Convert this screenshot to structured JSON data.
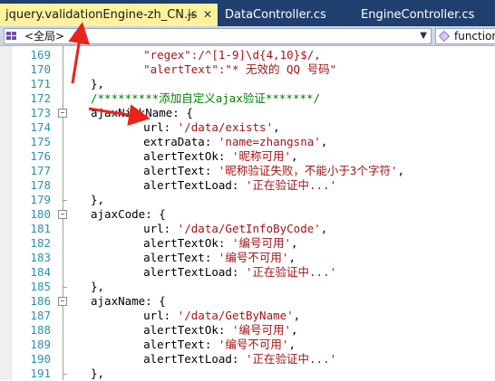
{
  "tabs": [
    {
      "label": "jquery.validationEngine-zh_CN.js",
      "active": true,
      "pin_icon": "pin-icon",
      "close_icon": "close-icon"
    },
    {
      "label": "DataController.cs",
      "active": false
    },
    {
      "label": "EngineController.cs",
      "active": false
    }
  ],
  "navbar": {
    "scope_label": "<全局>",
    "member_label": "function"
  },
  "editor": {
    "lines": [
      {
        "num": "169",
        "segs": [
          {
            "t": "    ",
            "k": ""
          },
          {
            "t": "\"regex\":/^[1-9]\\d{4,10}$/,",
            "k": "s"
          }
        ]
      },
      {
        "num": "170",
        "segs": [
          {
            "t": "    ",
            "k": ""
          },
          {
            "t": "\"alertText\":\"* 无效的 QQ 号码\"",
            "k": "s"
          }
        ]
      },
      {
        "num": "171",
        "segs": [
          {
            "t": "},",
            "k": ""
          }
        ]
      },
      {
        "num": "172",
        "segs": [
          {
            "t": "/*********添加自定义ajax验证*******/",
            "k": "c"
          }
        ]
      },
      {
        "num": "173",
        "segs": [
          {
            "t": "ajaxNickName: {",
            "k": ""
          }
        ]
      },
      {
        "num": "174",
        "segs": [
          {
            "t": "    url: ",
            "k": ""
          },
          {
            "t": "'/data/exists'",
            "k": "s"
          },
          {
            "t": ",",
            "k": ""
          }
        ]
      },
      {
        "num": "175",
        "segs": [
          {
            "t": "    extraData: ",
            "k": ""
          },
          {
            "t": "'name=zhangsna'",
            "k": "s"
          },
          {
            "t": ",",
            "k": ""
          }
        ]
      },
      {
        "num": "176",
        "segs": [
          {
            "t": "    alertTextOk: ",
            "k": ""
          },
          {
            "t": "'昵称可用'",
            "k": "s"
          },
          {
            "t": ",",
            "k": ""
          }
        ]
      },
      {
        "num": "177",
        "segs": [
          {
            "t": "    alertText: ",
            "k": ""
          },
          {
            "t": "'昵称验证失败，不能小于3个字符'",
            "k": "s"
          },
          {
            "t": ",",
            "k": ""
          }
        ]
      },
      {
        "num": "178",
        "segs": [
          {
            "t": "    alertTextLoad: ",
            "k": ""
          },
          {
            "t": "'正在验证中...'",
            "k": "s"
          }
        ]
      },
      {
        "num": "179",
        "segs": [
          {
            "t": "},",
            "k": ""
          }
        ]
      },
      {
        "num": "180",
        "segs": [
          {
            "t": "ajaxCode: {",
            "k": ""
          }
        ]
      },
      {
        "num": "181",
        "segs": [
          {
            "t": "    url: ",
            "k": ""
          },
          {
            "t": "'/data/GetInfoByCode'",
            "k": "s"
          },
          {
            "t": ",",
            "k": ""
          }
        ]
      },
      {
        "num": "182",
        "segs": [
          {
            "t": "    alertTextOk: ",
            "k": ""
          },
          {
            "t": "'编号可用'",
            "k": "s"
          },
          {
            "t": ",",
            "k": ""
          }
        ]
      },
      {
        "num": "183",
        "segs": [
          {
            "t": "    alertText: ",
            "k": ""
          },
          {
            "t": "'编号不可用'",
            "k": "s"
          },
          {
            "t": ",",
            "k": ""
          }
        ]
      },
      {
        "num": "184",
        "segs": [
          {
            "t": "    alertTextLoad: ",
            "k": ""
          },
          {
            "t": "'正在验证中...'",
            "k": "s"
          }
        ]
      },
      {
        "num": "185",
        "segs": [
          {
            "t": "},",
            "k": ""
          }
        ]
      },
      {
        "num": "186",
        "segs": [
          {
            "t": "ajaxName: {",
            "k": ""
          }
        ]
      },
      {
        "num": "187",
        "segs": [
          {
            "t": "    url: ",
            "k": ""
          },
          {
            "t": "'/data/GetByName'",
            "k": "s"
          },
          {
            "t": ",",
            "k": ""
          }
        ]
      },
      {
        "num": "188",
        "segs": [
          {
            "t": "    alertTextOk: ",
            "k": ""
          },
          {
            "t": "'编号可用'",
            "k": "s"
          },
          {
            "t": ",",
            "k": ""
          }
        ]
      },
      {
        "num": "189",
        "segs": [
          {
            "t": "    alertText: ",
            "k": ""
          },
          {
            "t": "'编号不可用'",
            "k": "s"
          },
          {
            "t": ",",
            "k": ""
          }
        ]
      },
      {
        "num": "190",
        "segs": [
          {
            "t": "    alertTextLoad: ",
            "k": ""
          },
          {
            "t": "'正在验证中...'",
            "k": "s"
          }
        ]
      },
      {
        "num": "191",
        "segs": [
          {
            "t": "},",
            "k": ""
          }
        ]
      }
    ]
  },
  "colors": {
    "tab_bar": "#1f3f6f",
    "active_tab": "#fff29d",
    "line_number": "#2b91af",
    "string": "#a31515",
    "comment": "#008000",
    "annotation_arrow": "#e8231c"
  }
}
